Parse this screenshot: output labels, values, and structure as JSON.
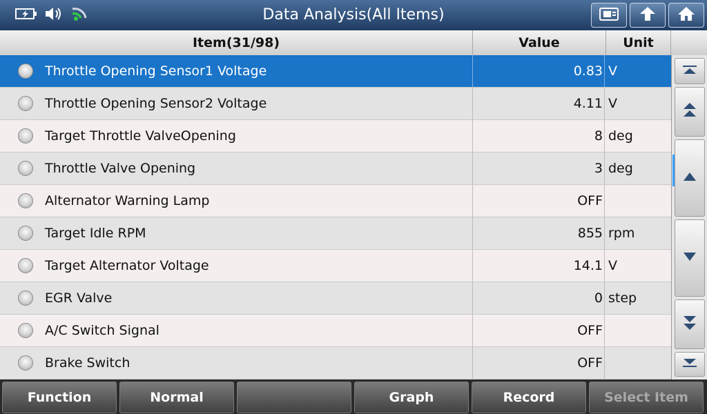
{
  "window": {
    "title": "Data Analysis(All Items)"
  },
  "header": {
    "item": "Item(31/98)",
    "value": "Value",
    "unit": "Unit"
  },
  "rows": [
    {
      "name": "Throttle Opening Sensor1 Voltage",
      "value": "0.83",
      "unit": "V"
    },
    {
      "name": "Throttle Opening Sensor2 Voltage",
      "value": "4.11",
      "unit": "V"
    },
    {
      "name": "Target Throttle ValveOpening",
      "value": "8",
      "unit": "deg"
    },
    {
      "name": "Throttle Valve Opening",
      "value": "3",
      "unit": "deg"
    },
    {
      "name": "Alternator Warning Lamp",
      "value": "OFF",
      "unit": ""
    },
    {
      "name": "Target Idle RPM",
      "value": "855",
      "unit": "rpm"
    },
    {
      "name": "Target Alternator Voltage",
      "value": "14.1",
      "unit": "V"
    },
    {
      "name": "EGR Valve",
      "value": "0",
      "unit": "step"
    },
    {
      "name": "A/C Switch Signal",
      "value": "OFF",
      "unit": ""
    },
    {
      "name": "Brake Switch",
      "value": "OFF",
      "unit": ""
    }
  ],
  "selected_row": 0,
  "icons": {
    "status": [
      "battery-icon",
      "speaker-icon",
      "wifi-icon"
    ],
    "top_buttons": [
      "screenshot-icon",
      "back-icon",
      "home-icon"
    ],
    "scroll": [
      "scroll-top-icon",
      "page-up-icon",
      "line-up-icon",
      "line-down-icon",
      "page-down-icon",
      "scroll-bottom-icon"
    ]
  },
  "bottom": {
    "function": "Function",
    "normal": "Normal",
    "empty": "",
    "graph": "Graph",
    "record": "Record",
    "select_item": "Select Item"
  },
  "colors": {
    "selected_row": "#1a74c8",
    "row_odd": "#f5eeee",
    "row_even": "#e3e3e3",
    "topbar": "#2a4a74"
  }
}
